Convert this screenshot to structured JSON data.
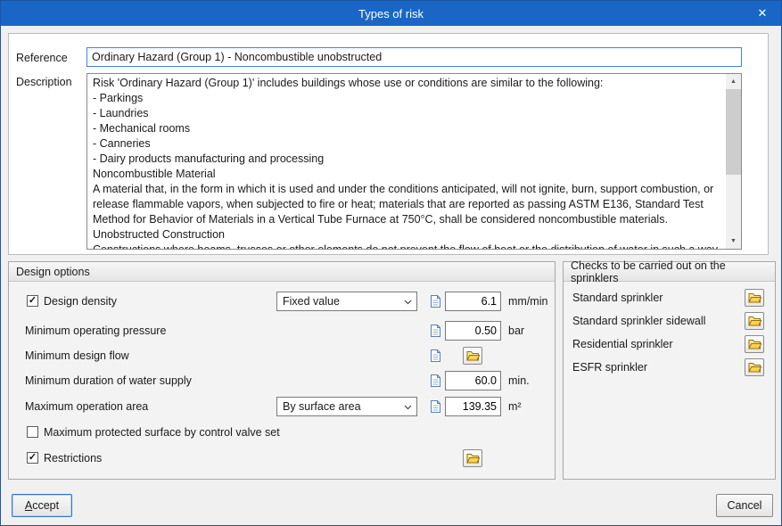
{
  "window": {
    "title": "Types of risk"
  },
  "icons": {
    "close": "✕",
    "scroll_up": "▲",
    "scroll_down": "▼"
  },
  "reference": {
    "label": "Reference",
    "value": "Ordinary Hazard (Group 1) - Noncombustible unobstructed"
  },
  "description": {
    "label": "Description",
    "value": "Risk 'Ordinary Hazard (Group 1)' includes buildings whose use or conditions are similar to the following:\n- Parkings\n- Laundries\n- Mechanical rooms\n- Canneries\n- Dairy products manufacturing and processing\nNoncombustible Material\nA material that, in the form in which it is used and under the conditions anticipated, will not ignite, burn, support combustion, or release flammable vapors, when subjected to fire or heat; materials that are reported as passing ASTM E136, Standard Test Method for Behavior of Materials in a Vertical Tube Furnace at 750°C, shall be considered noncombustible materials.\nUnobstructed Construction\nConstructions where beams, trusses or other elements do not prevent the flow of heat or the distribution of water in such a way as to affect the ability of the sprinkler to control or suppress the fire. This type of construction contains non-solid horizontal structural"
  },
  "design_options": {
    "title": "Design options",
    "density": {
      "label": "Design density",
      "check": "✓",
      "dropdown": "Fixed value",
      "value": "6.1",
      "unit": "mm/min"
    },
    "min_pressure": {
      "label": "Minimum operating pressure",
      "value": "0.50",
      "unit": "bar"
    },
    "min_flow": {
      "label": "Minimum design flow"
    },
    "min_duration": {
      "label": "Minimum duration of water supply",
      "value": "60.0",
      "unit": "min."
    },
    "max_area": {
      "label": "Maximum operation area",
      "dropdown": "By surface area",
      "value": "139.35",
      "unit": "m²"
    },
    "max_protected": {
      "label": "Maximum protected surface by control valve set",
      "check": ""
    },
    "restrictions": {
      "label": "Restrictions",
      "check": "✓"
    }
  },
  "checks": {
    "title": "Checks to be carried out on the sprinklers",
    "items": [
      "Standard sprinkler",
      "Standard sprinkler sidewall",
      "Residential sprinkler",
      "ESFR sprinkler"
    ]
  },
  "buttons": {
    "accept_accel": "A",
    "accept_rest": "ccept",
    "cancel": "Cancel"
  }
}
